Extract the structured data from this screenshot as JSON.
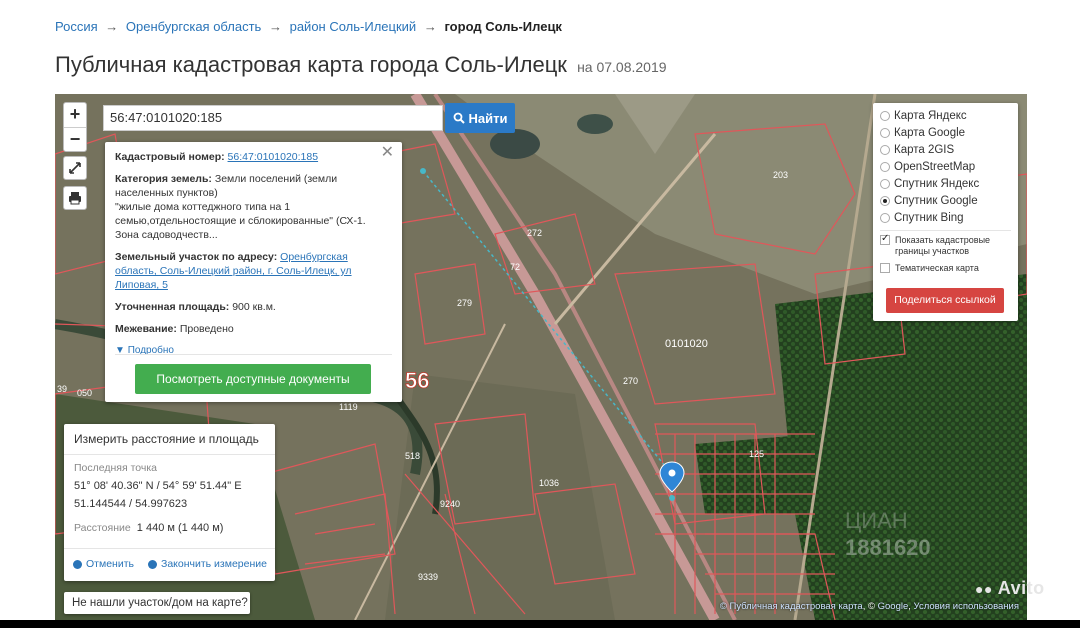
{
  "breadcrumb": {
    "items": [
      "Россия",
      "Оренбургская область",
      "район Соль-Илецкий"
    ],
    "separator": "→",
    "current": "город Соль-Илецк"
  },
  "page": {
    "title": "Публичная кадастровая карта города Соль-Илецк",
    "date_label": "на 07.08.2019"
  },
  "search": {
    "value": "56:47:0101020:185",
    "button_label": "Найти"
  },
  "map_controls": {
    "zoom_in": "+",
    "zoom_out": "−"
  },
  "popup": {
    "cadastral_label": "Кадастровый номер:",
    "cadastral_value": "56:47:0101020:185",
    "category_label": "Категория земель:",
    "category_value": "Земли поселений (земли населенных пунктов)",
    "usage_value": "\"жилые дома коттеджного типа на 1 семью,отдельностоящие и сблокированные\" (СХ-1. Зона садоводчеств...",
    "address_label": "Земельный участок по адресу:",
    "address_value": "Оренбургская область, Соль-Илецкий район, г. Соль-Илецк, ул Липовая, 5",
    "area_label": "Уточненная площадь:",
    "area_value": "900 кв.м.",
    "survey_label": "Межевание:",
    "survey_value": "Проведено",
    "more_link": "Подробно",
    "docs_button": "Посмотреть доступные документы"
  },
  "measure": {
    "title": "Измерить расстояние и площадь",
    "last_point_label": "Последняя точка",
    "coords_dms": "51° 08' 40.36\" N / 54° 59' 51.44\" E",
    "coords_dec": "51.144544 / 54.997623",
    "distance_label": "Расстояние",
    "distance_value": "1 440 м (1 440 м)",
    "cancel": "Отменить",
    "finish": "Закончить измерение"
  },
  "notfound": "Не нашли участок/дом на карте?",
  "layers": {
    "options": [
      {
        "label": "Карта Яндекс",
        "selected": false
      },
      {
        "label": "Карта Google",
        "selected": false
      },
      {
        "label": "Карта 2GIS",
        "selected": false
      },
      {
        "label": "OpenStreetMap",
        "selected": false
      },
      {
        "label": "Спутник Яндекс",
        "selected": false
      },
      {
        "label": "Спутник Google",
        "selected": true
      },
      {
        "label": "Спутник Bing",
        "selected": false
      }
    ],
    "show_boundaries": "Показать кадастровые границы участков",
    "show_boundaries_checked": true,
    "thematic": "Тематическая карта",
    "thematic_checked": false,
    "share_button": "Поделиться ссылкой"
  },
  "map_labels": {
    "region_number": "56",
    "quarter": "0101020",
    "parcels": [
      "203",
      "272",
      "279",
      "72",
      "270",
      "1119",
      "518",
      "1036",
      "9240",
      "9339",
      "125",
      "39",
      "050"
    ]
  },
  "attribution": {
    "prefix": "©",
    "map_name": "Публичная кадастровая карта",
    "google_prefix": ", ©",
    "google": "Google",
    "terms_sep": ",",
    "terms": "Условия использования"
  },
  "watermark": {
    "brand": "Avito",
    "number": "1881620",
    "faint": "ЦИАН"
  },
  "colors": {
    "link": "#2a74b8",
    "search_button": "#2b7ac7",
    "docs_button": "#43ad4f",
    "share_button": "#d64541",
    "parcel_lines": "#e0575a"
  }
}
